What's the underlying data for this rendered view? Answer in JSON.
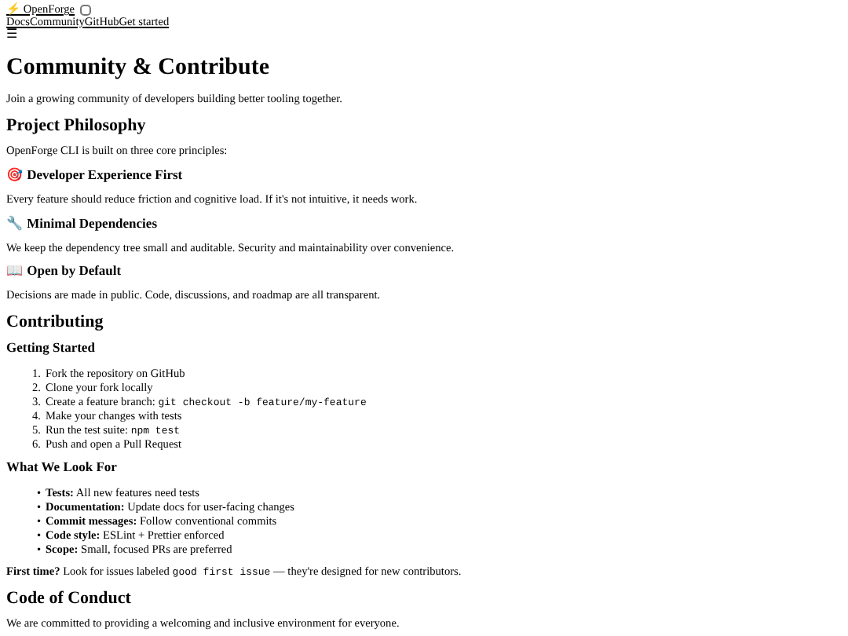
{
  "header": {
    "logo": "⚡ OpenForge",
    "toggle": {
      "checked": false
    },
    "nav": [
      "Docs",
      "Community",
      "GitHub",
      "Get started"
    ],
    "menu": "☰"
  },
  "blocks": [
    {
      "kind": "h1",
      "text": "Community & Contribute"
    },
    {
      "kind": "p",
      "parts": [
        {
          "kind": "text",
          "text": "Join a growing community of developers building better tooling together."
        }
      ]
    },
    {
      "kind": "h2",
      "text": "Project Philosophy"
    },
    {
      "kind": "p",
      "parts": [
        {
          "kind": "text",
          "text": "OpenForge CLI is built on three core principles:"
        }
      ]
    },
    {
      "kind": "h3",
      "text": "🎯 Developer Experience First"
    },
    {
      "kind": "p",
      "parts": [
        {
          "kind": "text",
          "text": "Every feature should reduce friction and cognitive load. If it's not intuitive, it needs work."
        }
      ]
    },
    {
      "kind": "h3",
      "text": "🔧 Minimal Dependencies"
    },
    {
      "kind": "p",
      "parts": [
        {
          "kind": "text",
          "text": "We keep the dependency tree small and auditable. Security and maintainability over convenience."
        }
      ]
    },
    {
      "kind": "h3",
      "text": "📖 Open by Default"
    },
    {
      "kind": "p",
      "parts": [
        {
          "kind": "text",
          "text": "Decisions are made in public. Code, discussions, and roadmap are all transparent."
        }
      ]
    },
    {
      "kind": "h2",
      "text": "Contributing"
    },
    {
      "kind": "h3",
      "text": "Getting Started"
    },
    {
      "kind": "ol",
      "items": [
        {
          "marker": "1.",
          "parts": [
            {
              "kind": "text",
              "text": "Fork the repository on GitHub"
            }
          ]
        },
        {
          "marker": "2.",
          "parts": [
            {
              "kind": "text",
              "text": "Clone your fork locally"
            }
          ]
        },
        {
          "marker": "3.",
          "parts": [
            {
              "kind": "text",
              "text": "Create a feature branch: "
            },
            {
              "kind": "code",
              "text": "git checkout -b feature/my-feature"
            }
          ]
        },
        {
          "marker": "4.",
          "parts": [
            {
              "kind": "text",
              "text": "Make your changes with tests"
            }
          ]
        },
        {
          "marker": "5.",
          "parts": [
            {
              "kind": "text",
              "text": "Run the test suite: "
            },
            {
              "kind": "code",
              "text": "npm test"
            }
          ]
        },
        {
          "marker": "6.",
          "parts": [
            {
              "kind": "text",
              "text": "Push and open a Pull Request"
            }
          ]
        }
      ]
    },
    {
      "kind": "h3",
      "text": "What We Look For"
    },
    {
      "kind": "ul",
      "items": [
        {
          "marker": "•",
          "parts": [
            {
              "kind": "bold",
              "text": "Tests:"
            },
            {
              "kind": "text",
              "text": " All new features need tests"
            }
          ]
        },
        {
          "marker": "•",
          "parts": [
            {
              "kind": "bold",
              "text": "Documentation:"
            },
            {
              "kind": "text",
              "text": " Update docs for user-facing changes"
            }
          ]
        },
        {
          "marker": "•",
          "parts": [
            {
              "kind": "bold",
              "text": "Commit messages:"
            },
            {
              "kind": "text",
              "text": " Follow conventional commits"
            }
          ]
        },
        {
          "marker": "•",
          "parts": [
            {
              "kind": "bold",
              "text": "Code style:"
            },
            {
              "kind": "text",
              "text": " ESLint + Prettier enforced"
            }
          ]
        },
        {
          "marker": "•",
          "parts": [
            {
              "kind": "bold",
              "text": "Scope:"
            },
            {
              "kind": "text",
              "text": " Small, focused PRs are preferred"
            }
          ]
        }
      ]
    },
    {
      "kind": "p",
      "parts": [
        {
          "kind": "bold",
          "text": "First time?"
        },
        {
          "kind": "text",
          "text": " Look for issues labeled "
        },
        {
          "kind": "code",
          "text": "good first issue"
        },
        {
          "kind": "text",
          "text": " — they're designed for new contributors."
        }
      ]
    },
    {
      "kind": "h2",
      "text": "Code of Conduct"
    },
    {
      "kind": "p",
      "parts": [
        {
          "kind": "text",
          "text": "We are committed to providing a welcoming and inclusive environment for everyone."
        }
      ]
    }
  ]
}
